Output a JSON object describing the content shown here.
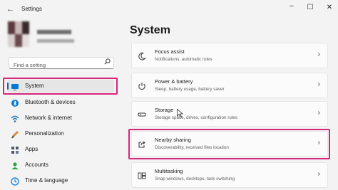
{
  "window": {
    "title": "Settings",
    "back_glyph": "←",
    "minimize_glyph": "–",
    "maximize_glyph": "☐",
    "close_glyph": "✕"
  },
  "search": {
    "placeholder": "Find a setting",
    "icon": "search-icon"
  },
  "sidebar": {
    "items": [
      {
        "label": "System",
        "icon": "monitor-icon",
        "selected": true,
        "icon_color": "#0078d4"
      },
      {
        "label": "Bluetooth & devices",
        "icon": "bluetooth-icon",
        "icon_color": "#0078d4"
      },
      {
        "label": "Network & internet",
        "icon": "network-icon",
        "icon_color": "#1b6fb3"
      },
      {
        "label": "Personalization",
        "icon": "brush-icon",
        "icon_color": "#d08a3a"
      },
      {
        "label": "Apps",
        "icon": "apps-icon",
        "icon_color": "#4c5a6b"
      },
      {
        "label": "Accounts",
        "icon": "accounts-icon",
        "icon_color": "#2ea043"
      },
      {
        "label": "Time & language",
        "icon": "globe-clock-icon",
        "icon_color": "#0078d4"
      }
    ]
  },
  "main": {
    "title": "System",
    "cards": [
      {
        "title": "Focus assist",
        "desc": "Notifications, automatic rules",
        "icon": "moon-icon"
      },
      {
        "title": "Power & battery",
        "desc": "Sleep, battery usage, battery saver",
        "icon": "power-icon"
      },
      {
        "title": "Storage",
        "desc": "Storage space, drives, configuration rules",
        "icon": "storage-icon"
      },
      {
        "title": "Nearby sharing",
        "desc": "Discoverability, received files location",
        "icon": "share-icon"
      },
      {
        "title": "Multitasking",
        "desc": "Snap windows, desktops, task switching",
        "icon": "multitasking-icon"
      }
    ],
    "chevron": "›"
  },
  "colors": {
    "accent": "#0067c0",
    "highlight": "#d6267c"
  }
}
